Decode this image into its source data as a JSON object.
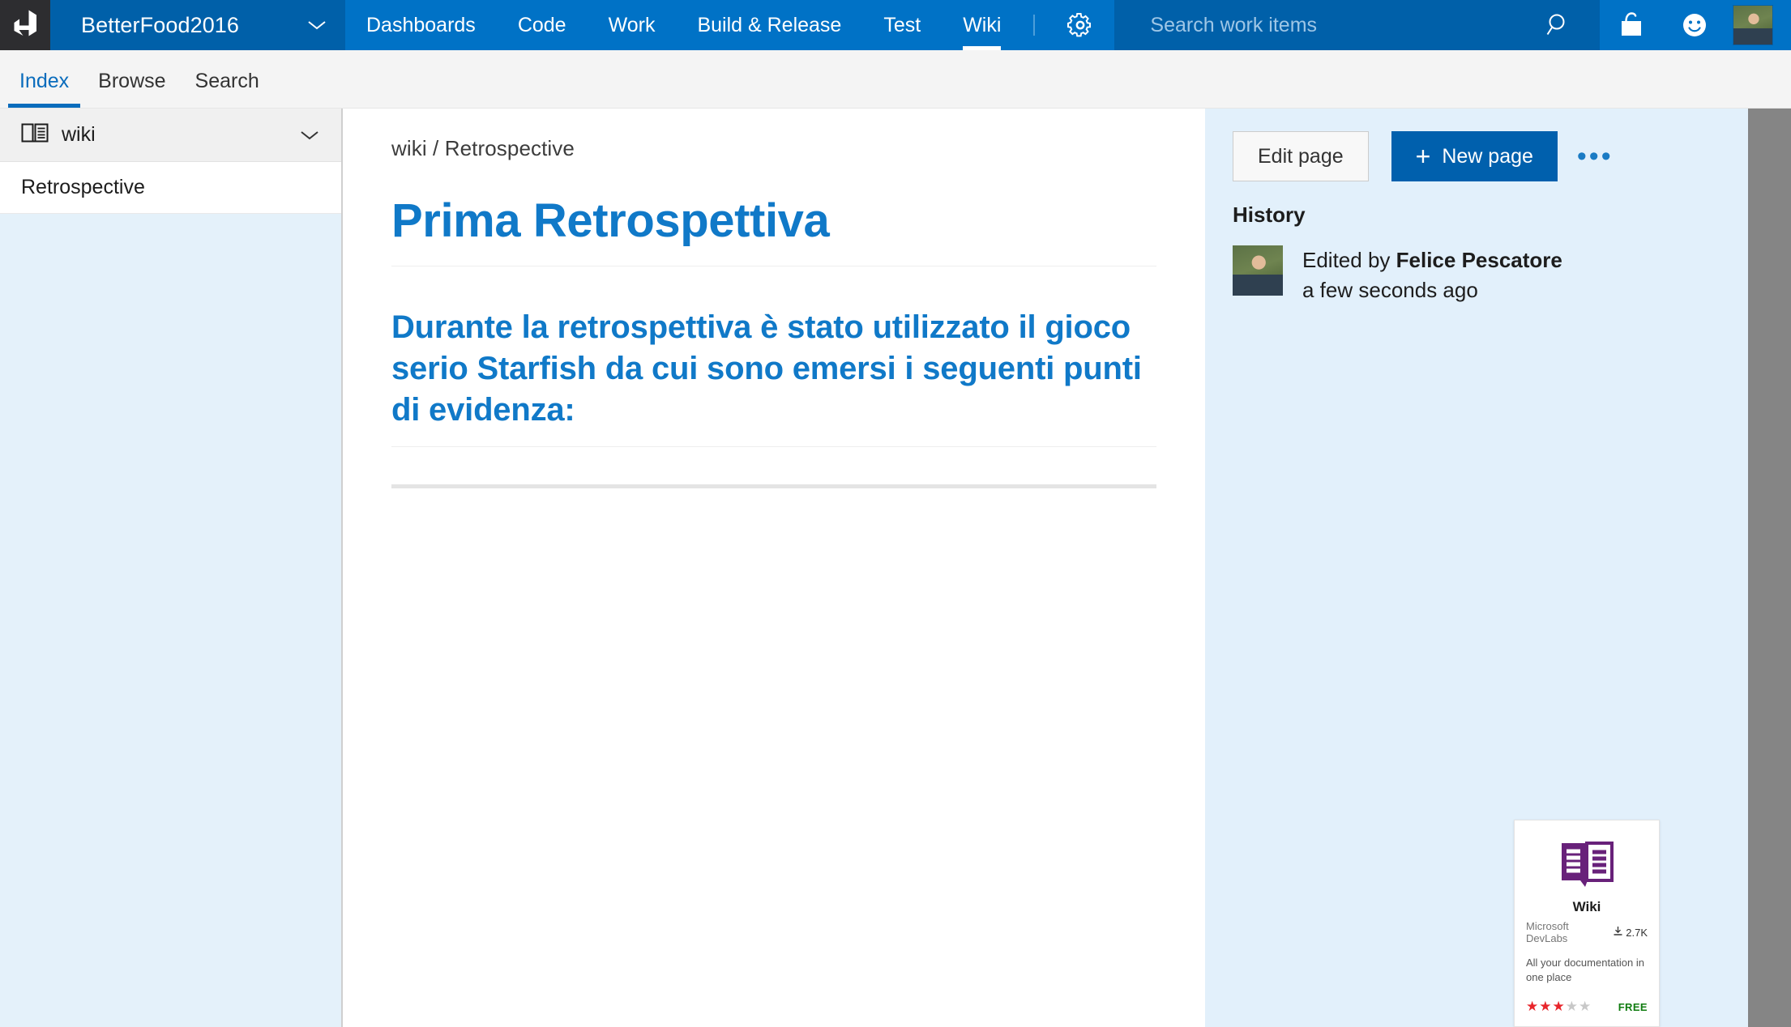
{
  "topbar": {
    "logo_icon": "azure-devops-logo-icon",
    "project_name": "BetterFood2016",
    "project_caret_icon": "chevron-down-icon",
    "nav_items": [
      {
        "label": "Dashboards",
        "active": false
      },
      {
        "label": "Code",
        "active": false
      },
      {
        "label": "Work",
        "active": false
      },
      {
        "label": "Build & Release",
        "active": false
      },
      {
        "label": "Test",
        "active": false
      },
      {
        "label": "Wiki",
        "active": true
      }
    ],
    "settings_icon": "gear-icon",
    "search": {
      "placeholder": "Search work items",
      "value": "",
      "submit_icon": "search-icon"
    },
    "marketplace_icon": "shopping-bag-icon",
    "feedback_icon": "smiley-face-icon",
    "avatar_icon": "user-avatar",
    "colors": {
      "logo_tile": "#2d2d30",
      "project_chip": "#0060a9",
      "nav_background": "#0072c6",
      "search_background": "#0060a9"
    }
  },
  "subnav": {
    "tabs": [
      {
        "label": "Index",
        "active": true
      },
      {
        "label": "Browse",
        "active": false
      },
      {
        "label": "Search",
        "active": false
      }
    ],
    "accent_color": "#0a6cbc"
  },
  "sidebar": {
    "root": {
      "icon": "open-book-icon",
      "label": "wiki",
      "collapse_icon": "chevron-down-icon"
    },
    "pages": [
      {
        "label": "Retrospective"
      }
    ]
  },
  "content": {
    "breadcrumb": "wiki / Retrospective",
    "heading": "Prima Retrospettiva",
    "subheading": "Durante la retrospettiva è stato utilizzato il gioco serio Starfish da cui sono emersi i seguenti punti di evidenza:",
    "heading_color": "#1079c8"
  },
  "rightpanel": {
    "edit_page_label": "Edit page",
    "new_page_label": "New page",
    "new_page_plus": "+",
    "more_actions_label": "•••",
    "history_title": "History",
    "history": [
      {
        "avatar": "user-avatar",
        "edited_by_prefix": "Edited by ",
        "author": "Felice Pescatore",
        "timestamp": "a few seconds ago"
      }
    ],
    "background_color": "#e2f0fb",
    "new_page_color": "#0060ad"
  },
  "wiki_card": {
    "icon": "open-book-icon",
    "icon_color": "#68217a",
    "title": "Wiki",
    "publisher": "Microsoft DevLabs",
    "installs_icon": "download-icon",
    "installs": "2.7K",
    "description": "All your documentation in one place",
    "rating_filled": 3,
    "rating_total": 5,
    "price": "FREE",
    "price_color": "#107c10",
    "star_on_color": "#e8252b"
  }
}
